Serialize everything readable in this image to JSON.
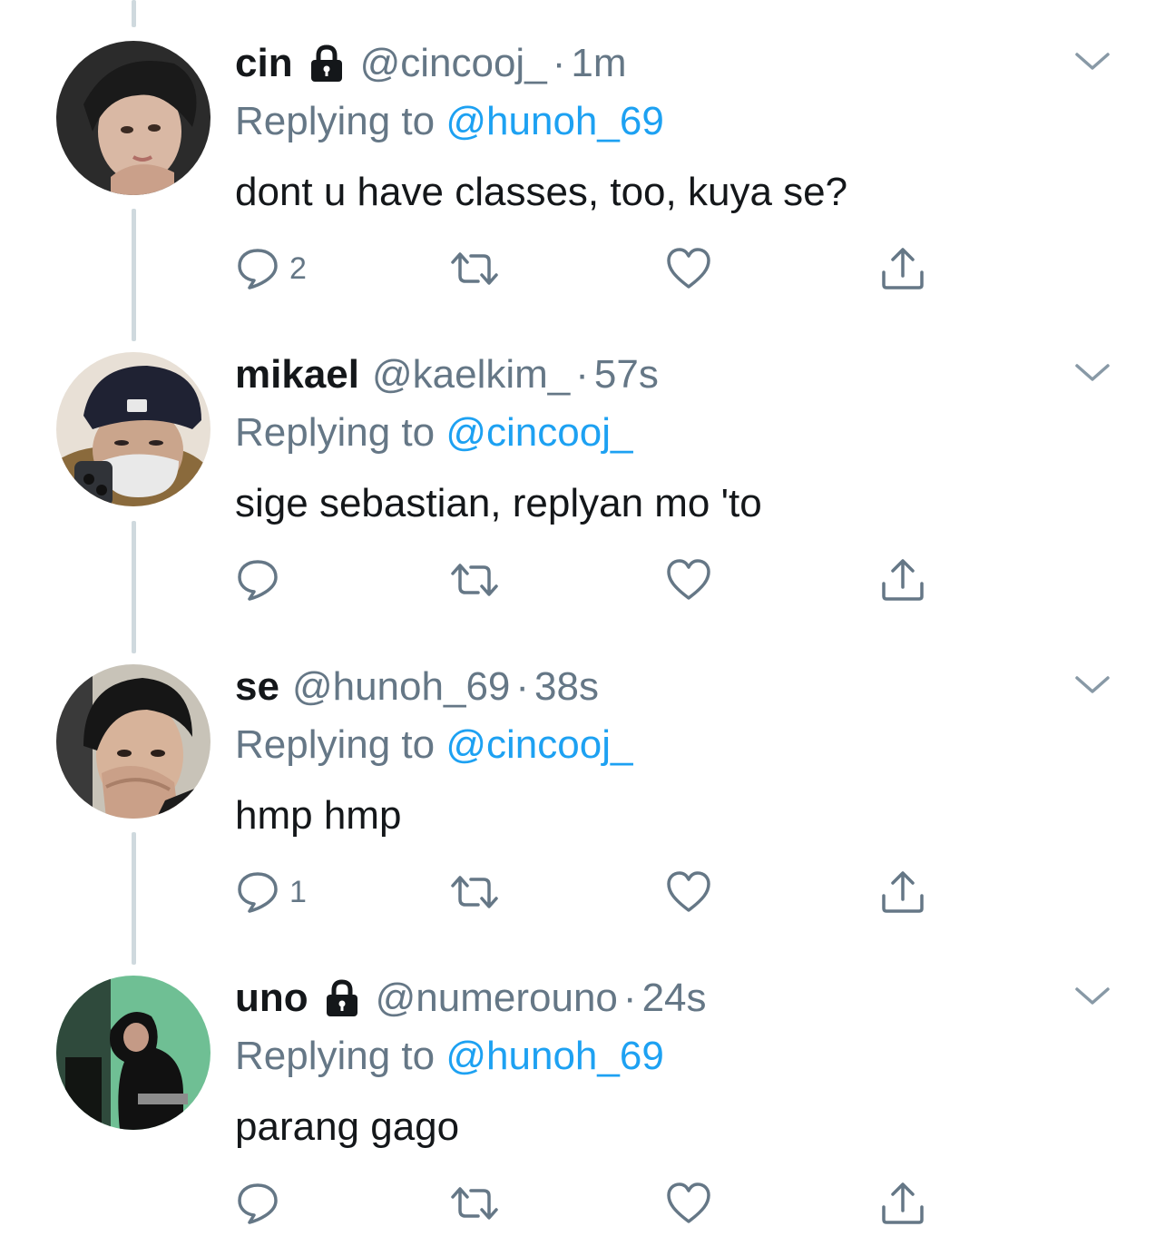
{
  "tweets": [
    {
      "name": "cin",
      "locked": true,
      "handle": "@cincooj_",
      "separator": "·",
      "time": "1m",
      "replying_prefix": "Replying to ",
      "replying_to": "@hunoh_69",
      "text": "dont u have classes, too, kuya se?",
      "reply_count": "2",
      "avatar_colors": {
        "bg": "#2b2b2b",
        "face": "#d9b8a4",
        "hair": "#1a1a1a"
      }
    },
    {
      "name": "mikael",
      "locked": false,
      "handle": "@kaelkim_",
      "separator": "·",
      "time": "57s",
      "replying_prefix": "Replying to ",
      "replying_to": "@cincooj_",
      "text": "sige sebastian, replyan mo 'to",
      "reply_count": "",
      "avatar_colors": {
        "bg": "#e8e0d6",
        "face": "#caa58c",
        "hair": "#1f2233"
      }
    },
    {
      "name": "se",
      "locked": false,
      "handle": "@hunoh_69",
      "separator": "·",
      "time": "38s",
      "replying_prefix": "Replying to ",
      "replying_to": "@cincooj_",
      "text": "hmp hmp",
      "reply_count": "1",
      "avatar_colors": {
        "bg": "#c8c3b8",
        "face": "#d7b39a",
        "hair": "#161616"
      }
    },
    {
      "name": "uno",
      "locked": true,
      "handle": "@numerouno",
      "separator": "·",
      "time": "24s",
      "replying_prefix": "Replying to ",
      "replying_to": "@hunoh_69",
      "text": "parang gago",
      "reply_count": "",
      "avatar_colors": {
        "bg": "#6fbf94",
        "face": "#c49a86",
        "hair": "#111111"
      }
    }
  ],
  "colors": {
    "text": "#14171a",
    "secondary": "#657786",
    "link": "#1da1f2",
    "thread_line": "#cfd9de"
  },
  "icons": [
    "lock-icon",
    "chevron-down-icon",
    "reply-icon",
    "retweet-icon",
    "like-icon",
    "share-icon"
  ]
}
